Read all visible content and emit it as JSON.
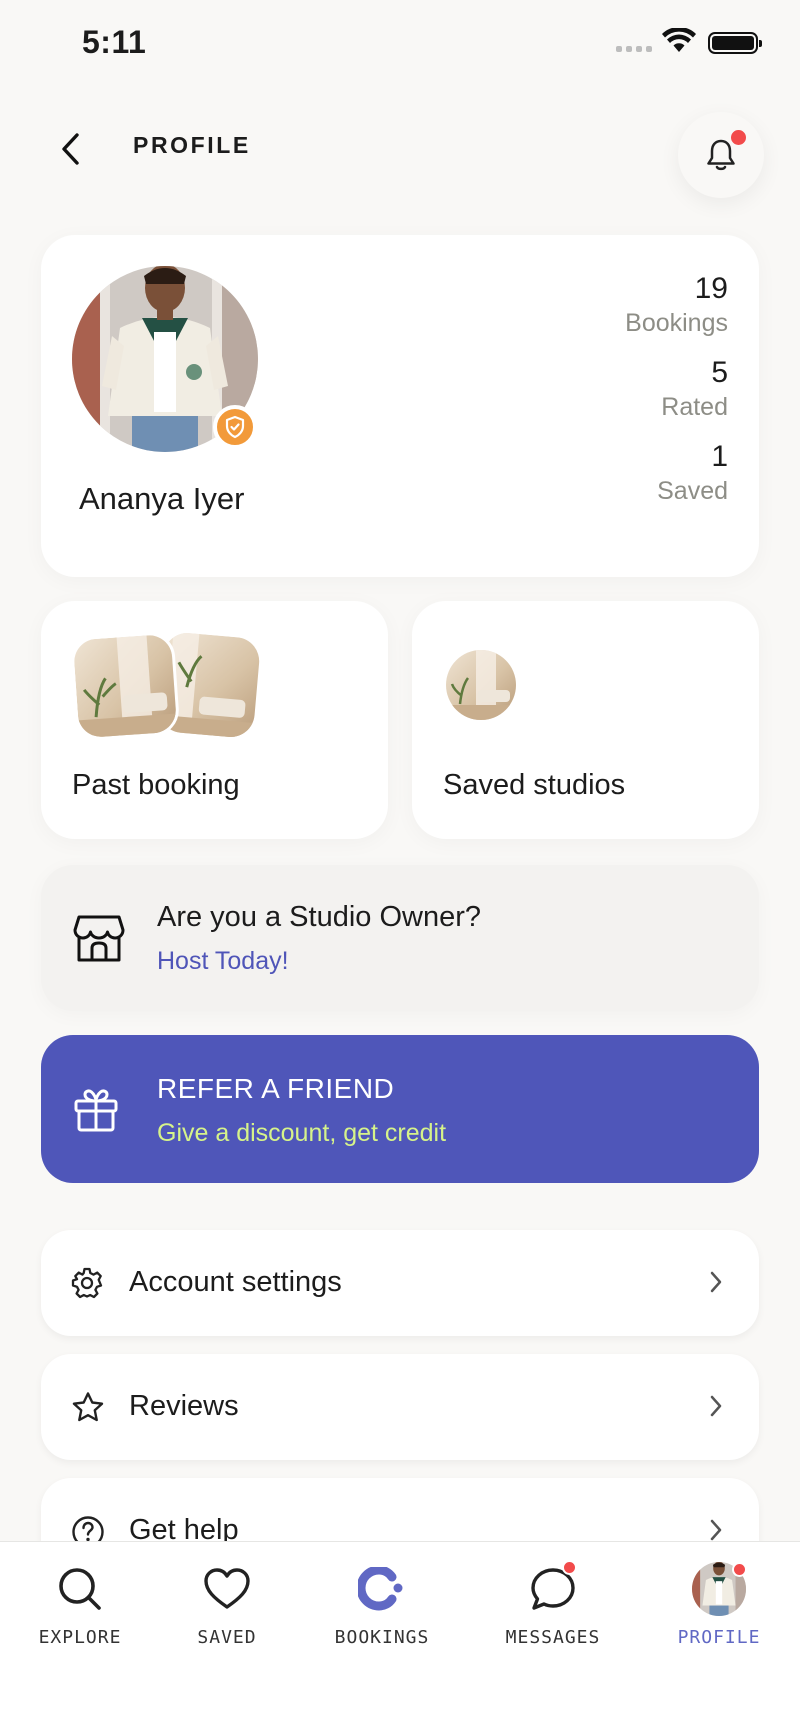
{
  "status_bar": {
    "time": "5:11"
  },
  "header": {
    "title": "PROFILE",
    "notification_unread": true
  },
  "profile": {
    "name": "Ananya Iyer",
    "verified": true,
    "stats": [
      {
        "value": "19",
        "label": "Bookings"
      },
      {
        "value": "5",
        "label": "Rated"
      },
      {
        "value": "1",
        "label": "Saved"
      }
    ]
  },
  "tiles": {
    "past_booking": "Past booking",
    "saved_studios": "Saved studios"
  },
  "owner_banner": {
    "title": "Are you a Studio Owner?",
    "link": "Host Today!"
  },
  "refer_banner": {
    "title": "REFER A FRIEND",
    "subtitle": "Give a discount, get credit"
  },
  "menu": [
    {
      "label": "Account settings",
      "icon": "gear-icon"
    },
    {
      "label": "Reviews",
      "icon": "star-icon"
    },
    {
      "label": "Get help",
      "icon": "help-icon"
    }
  ],
  "bottom_nav": [
    {
      "label": "EXPLORE",
      "icon": "search-icon"
    },
    {
      "label": "SAVED",
      "icon": "heart-icon"
    },
    {
      "label": "BOOKINGS",
      "icon": "bookings-logo-icon"
    },
    {
      "label": "MESSAGES",
      "icon": "chat-icon",
      "badge": true
    },
    {
      "label": "PROFILE",
      "icon": "avatar",
      "badge": true,
      "active": true
    }
  ],
  "colors": {
    "accent": "#4f56b9",
    "accent_link": "#4f55b8",
    "refer_subtitle": "#d6f38a",
    "badge_red": "#f24b4b",
    "verified_orange": "#f29a3a",
    "page_background": "#f9f8f6"
  }
}
